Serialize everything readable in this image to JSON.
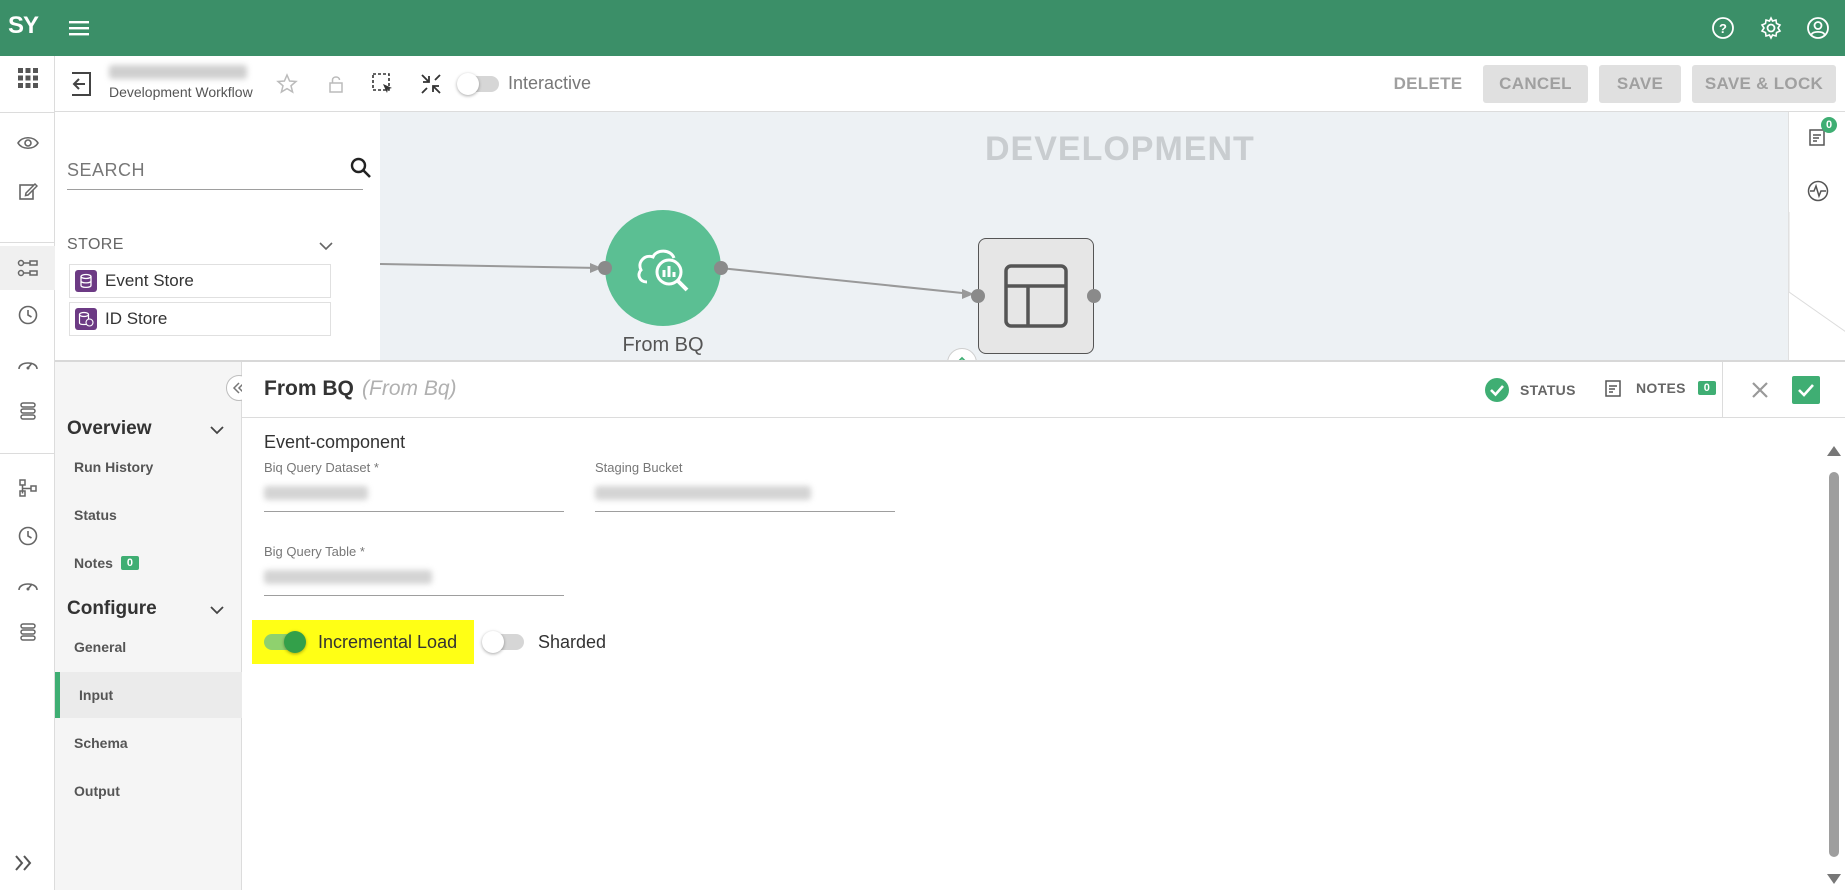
{
  "app": {
    "logo_text": "SY",
    "brand_color": "#3b8f68",
    "accent_color": "#3fae73"
  },
  "topbar": {
    "icons": [
      "menu-icon",
      "help-icon",
      "gear-icon",
      "account-icon"
    ]
  },
  "leftrail": {
    "icons": [
      "eye-icon",
      "edit-icon",
      "workflow-icon",
      "history-icon",
      "dashboard-icon",
      "layers-icon",
      "tree-icon",
      "clock-icon",
      "gauge-icon",
      "stack-icon",
      "expand-icon"
    ]
  },
  "toolbar": {
    "workflow_subtitle": "Development Workflow",
    "interactive_label": "Interactive",
    "interactive_on": false,
    "delete_label": "DELETE",
    "cancel_label": "CANCEL",
    "save_label": "SAVE",
    "save_lock_label": "SAVE & LOCK"
  },
  "palette": {
    "search_placeholder": "SEARCH",
    "section_label": "STORE",
    "items": [
      {
        "label": "Event Store"
      },
      {
        "label": "ID Store"
      }
    ]
  },
  "canvas": {
    "environment_label": "DEVELOPMENT",
    "node_label": "From BQ",
    "right_rail_badge": "0"
  },
  "panel": {
    "title": "From BQ",
    "subtitle": "(From Bq)",
    "status_label": "STATUS",
    "notes_label": "NOTES",
    "notes_count": "0",
    "nav": {
      "overview_label": "Overview",
      "run_history": "Run History",
      "status": "Status",
      "notes": "Notes",
      "notes_badge": "0",
      "configure_label": "Configure",
      "general": "General",
      "input": "Input",
      "schema": "Schema",
      "output": "Output"
    },
    "form": {
      "section_title": "Event-component",
      "dataset_label": "Biq Query Dataset *",
      "bucket_label": "Staging Bucket",
      "table_label": "Big Query Table *",
      "incremental_label": "Incremental Load",
      "incremental_on": true,
      "sharded_label": "Sharded",
      "sharded_on": false
    }
  }
}
